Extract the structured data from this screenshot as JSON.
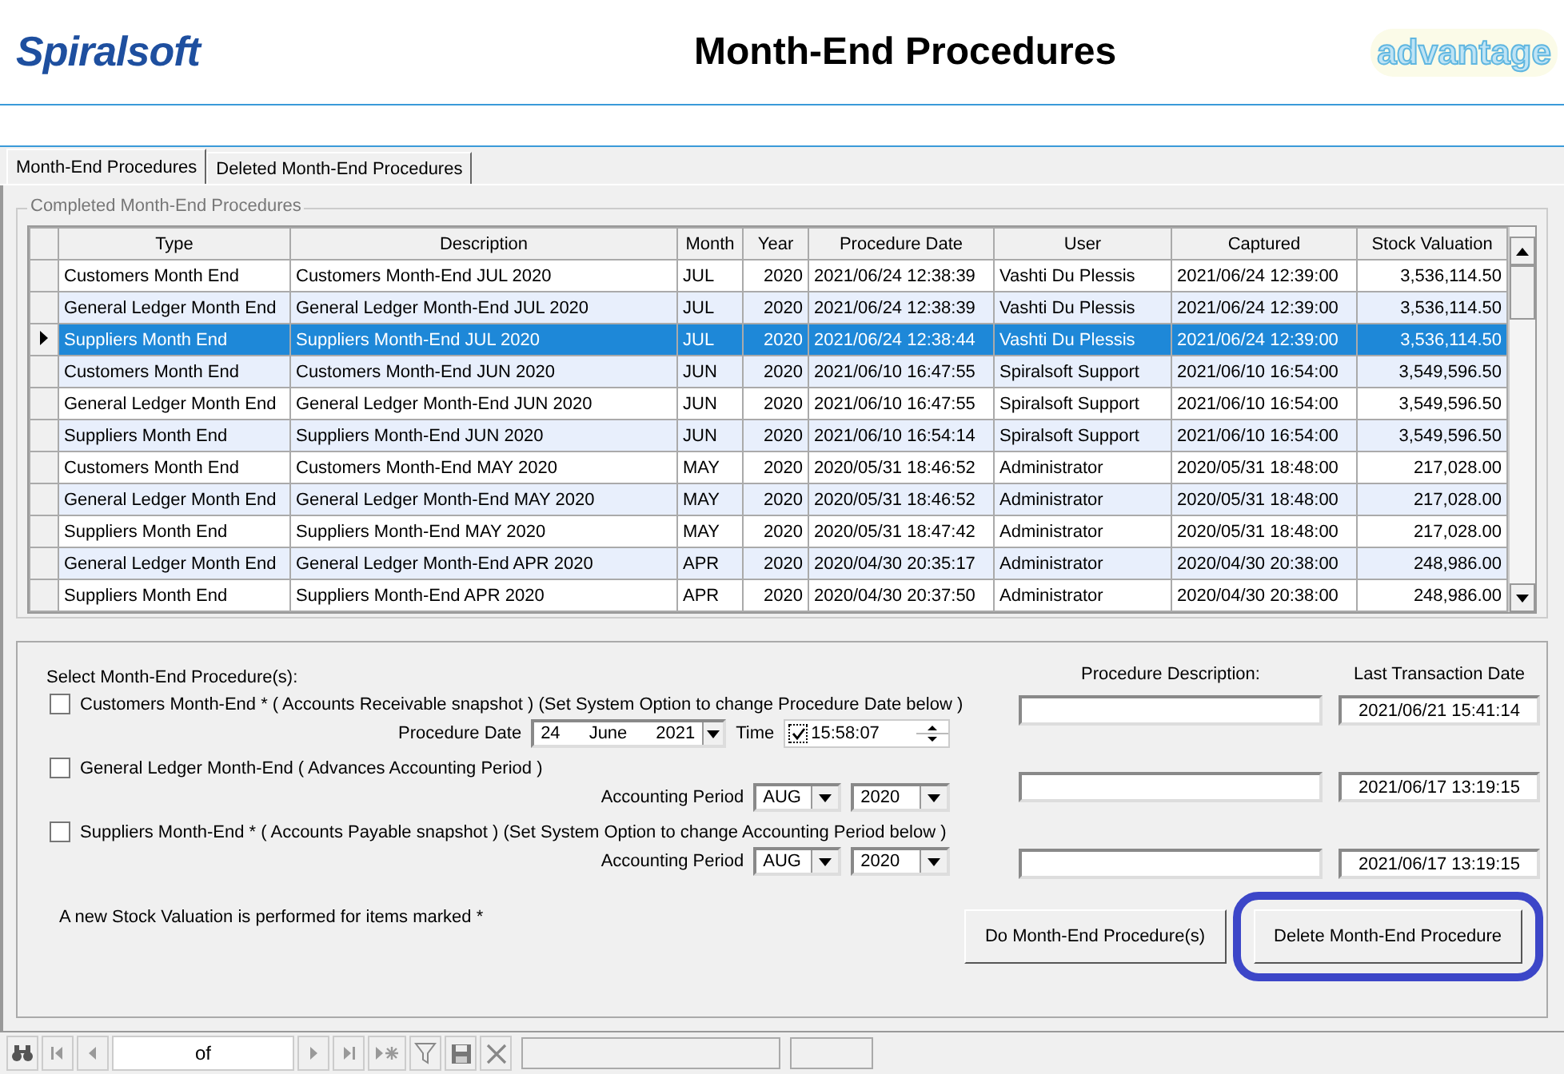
{
  "header": {
    "logo": "Spiralsoft",
    "title": "Month-End Procedures",
    "brand": "advantage"
  },
  "tabs": [
    {
      "label": "Month-End Procedures",
      "selected": true
    },
    {
      "label": "Deleted Month-End Procedures",
      "selected": false
    }
  ],
  "grid": {
    "caption": "Completed Month-End Procedures",
    "columns": [
      {
        "label": "Type"
      },
      {
        "label": "Description"
      },
      {
        "label": "Month"
      },
      {
        "label": "Year"
      },
      {
        "label": "Procedure Date"
      },
      {
        "label": "User"
      },
      {
        "label": "Captured"
      },
      {
        "label": "Stock Valuation"
      }
    ],
    "rows": [
      {
        "selected": false,
        "cells": [
          "Customers Month End",
          "Customers Month-End JUL 2020",
          "JUL",
          "2020",
          "2021/06/24 12:38:39",
          "Vashti Du Plessis",
          "2021/06/24 12:39:00",
          "3,536,114.50"
        ]
      },
      {
        "selected": false,
        "cells": [
          "General Ledger Month End",
          "General Ledger Month-End JUL 2020",
          "JUL",
          "2020",
          "2021/06/24 12:38:39",
          "Vashti Du Plessis",
          "2021/06/24 12:39:00",
          "3,536,114.50"
        ]
      },
      {
        "selected": true,
        "cells": [
          "Suppliers Month End",
          "Suppliers Month-End JUL 2020",
          "JUL",
          "2020",
          "2021/06/24 12:38:44",
          "Vashti Du Plessis",
          "2021/06/24 12:39:00",
          "3,536,114.50"
        ]
      },
      {
        "selected": false,
        "cells": [
          "Customers Month End",
          "Customers Month-End JUN 2020",
          "JUN",
          "2020",
          "2021/06/10 16:47:55",
          "Spiralsoft Support",
          "2021/06/10 16:54:00",
          "3,549,596.50"
        ]
      },
      {
        "selected": false,
        "cells": [
          "General Ledger Month End",
          "General Ledger Month-End JUN 2020",
          "JUN",
          "2020",
          "2021/06/10 16:47:55",
          "Spiralsoft Support",
          "2021/06/10 16:54:00",
          "3,549,596.50"
        ]
      },
      {
        "selected": false,
        "cells": [
          "Suppliers Month End",
          "Suppliers Month-End JUN 2020",
          "JUN",
          "2020",
          "2021/06/10 16:54:14",
          "Spiralsoft Support",
          "2021/06/10 16:54:00",
          "3,549,596.50"
        ]
      },
      {
        "selected": false,
        "cells": [
          "Customers Month End",
          "Customers Month-End MAY 2020",
          "MAY",
          "2020",
          "2020/05/31 18:46:52",
          "Administrator",
          "2020/05/31 18:48:00",
          "217,028.00"
        ]
      },
      {
        "selected": false,
        "cells": [
          "General Ledger Month End",
          "General Ledger Month-End MAY 2020",
          "MAY",
          "2020",
          "2020/05/31 18:46:52",
          "Administrator",
          "2020/05/31 18:48:00",
          "217,028.00"
        ]
      },
      {
        "selected": false,
        "cells": [
          "Suppliers Month End",
          "Suppliers Month-End MAY 2020",
          "MAY",
          "2020",
          "2020/05/31 18:47:42",
          "Administrator",
          "2020/05/31 18:48:00",
          "217,028.00"
        ]
      },
      {
        "selected": false,
        "cells": [
          "General Ledger Month End",
          "General Ledger Month-End APR 2020",
          "APR",
          "2020",
          "2020/04/30 20:35:17",
          "Administrator",
          "2020/04/30 20:38:00",
          "248,986.00"
        ]
      },
      {
        "selected": false,
        "cells": [
          "Suppliers Month End",
          "Suppliers Month-End APR 2020",
          "APR",
          "2020",
          "2020/04/30 20:37:50",
          "Administrator",
          "2020/04/30 20:38:00",
          "248,986.00"
        ]
      }
    ]
  },
  "form": {
    "heading": "Select Month-End Procedure(s):",
    "description_header": "Procedure Description:",
    "last_date_header": "Last Transaction Date",
    "procedures": [
      {
        "kind": "date",
        "label": "Customers Month-End *  ( Accounts Receivable snapshot )  (Set System Option to change Procedure Date below )",
        "checked": false,
        "field_label": "Procedure Date",
        "day": "24",
        "month": "June",
        "year": "2021",
        "time_label": "Time",
        "time_checked": true,
        "time": "15:58:07",
        "last_date": "2021/06/21 15:41:14"
      },
      {
        "kind": "period",
        "label": "General Ledger Month-End  ( Advances Accounting Period )",
        "checked": false,
        "field_label": "Accounting  Period",
        "month": "AUG",
        "year": "2020",
        "last_date": "2021/06/17 13:19:15"
      },
      {
        "kind": "period",
        "label": "Suppliers Month-End *  ( Accounts Payable snapshot )  (Set System Option to change Accounting Period below )",
        "checked": false,
        "field_label": "Accounting Period",
        "month": "AUG",
        "year": "2020",
        "last_date": "2021/06/17 13:19:15"
      }
    ],
    "footnote": "A new Stock Valuation is performed for items marked *",
    "buttons": [
      {
        "label": "Do Month-End Procedure(s)",
        "highlighted": false
      },
      {
        "label": "Delete Month-End Procedure",
        "highlighted": true
      }
    ]
  },
  "navigator": {
    "position": "of"
  }
}
